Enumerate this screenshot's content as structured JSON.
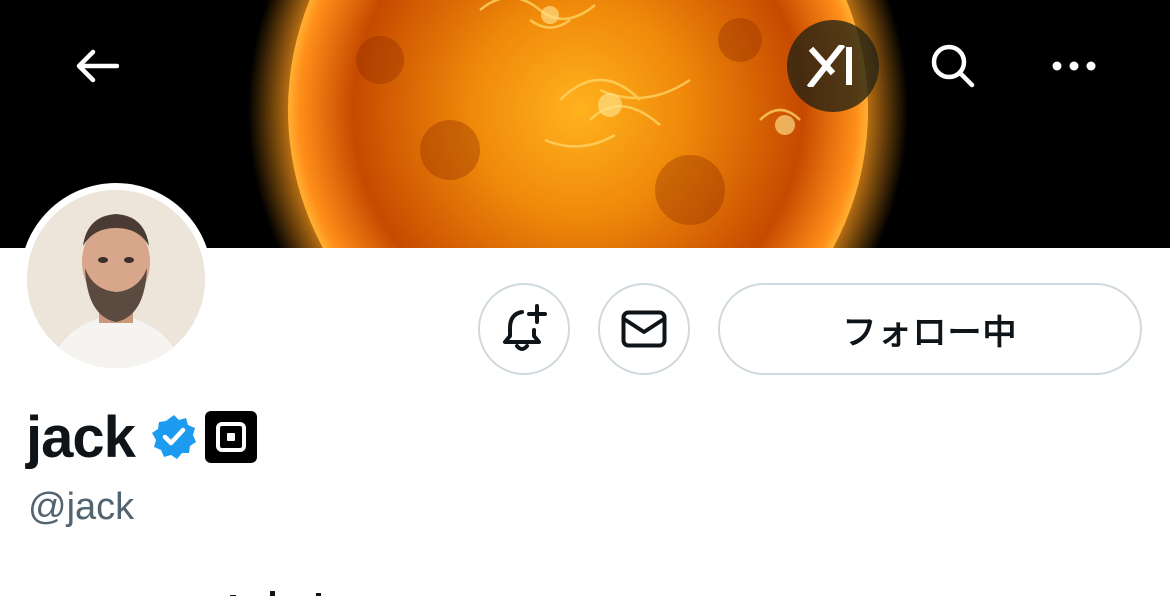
{
  "header": {
    "back_icon": "arrow-left-icon",
    "grok_icon": "grok-logo-icon",
    "search_icon": "search-icon",
    "more_icon": "more-horizontal-icon"
  },
  "profile": {
    "display_name": "jack",
    "handle": "@jack",
    "verified": true,
    "affiliation_icon": "square-logo-icon"
  },
  "actions": {
    "notify_icon": "bell-plus-icon",
    "message_icon": "envelope-icon",
    "follow_label": "フォロー中"
  },
  "colors": {
    "text_primary": "#0f1419",
    "text_secondary": "#536471",
    "border": "#cfd9de",
    "verified_blue": "#1d9bf0"
  }
}
